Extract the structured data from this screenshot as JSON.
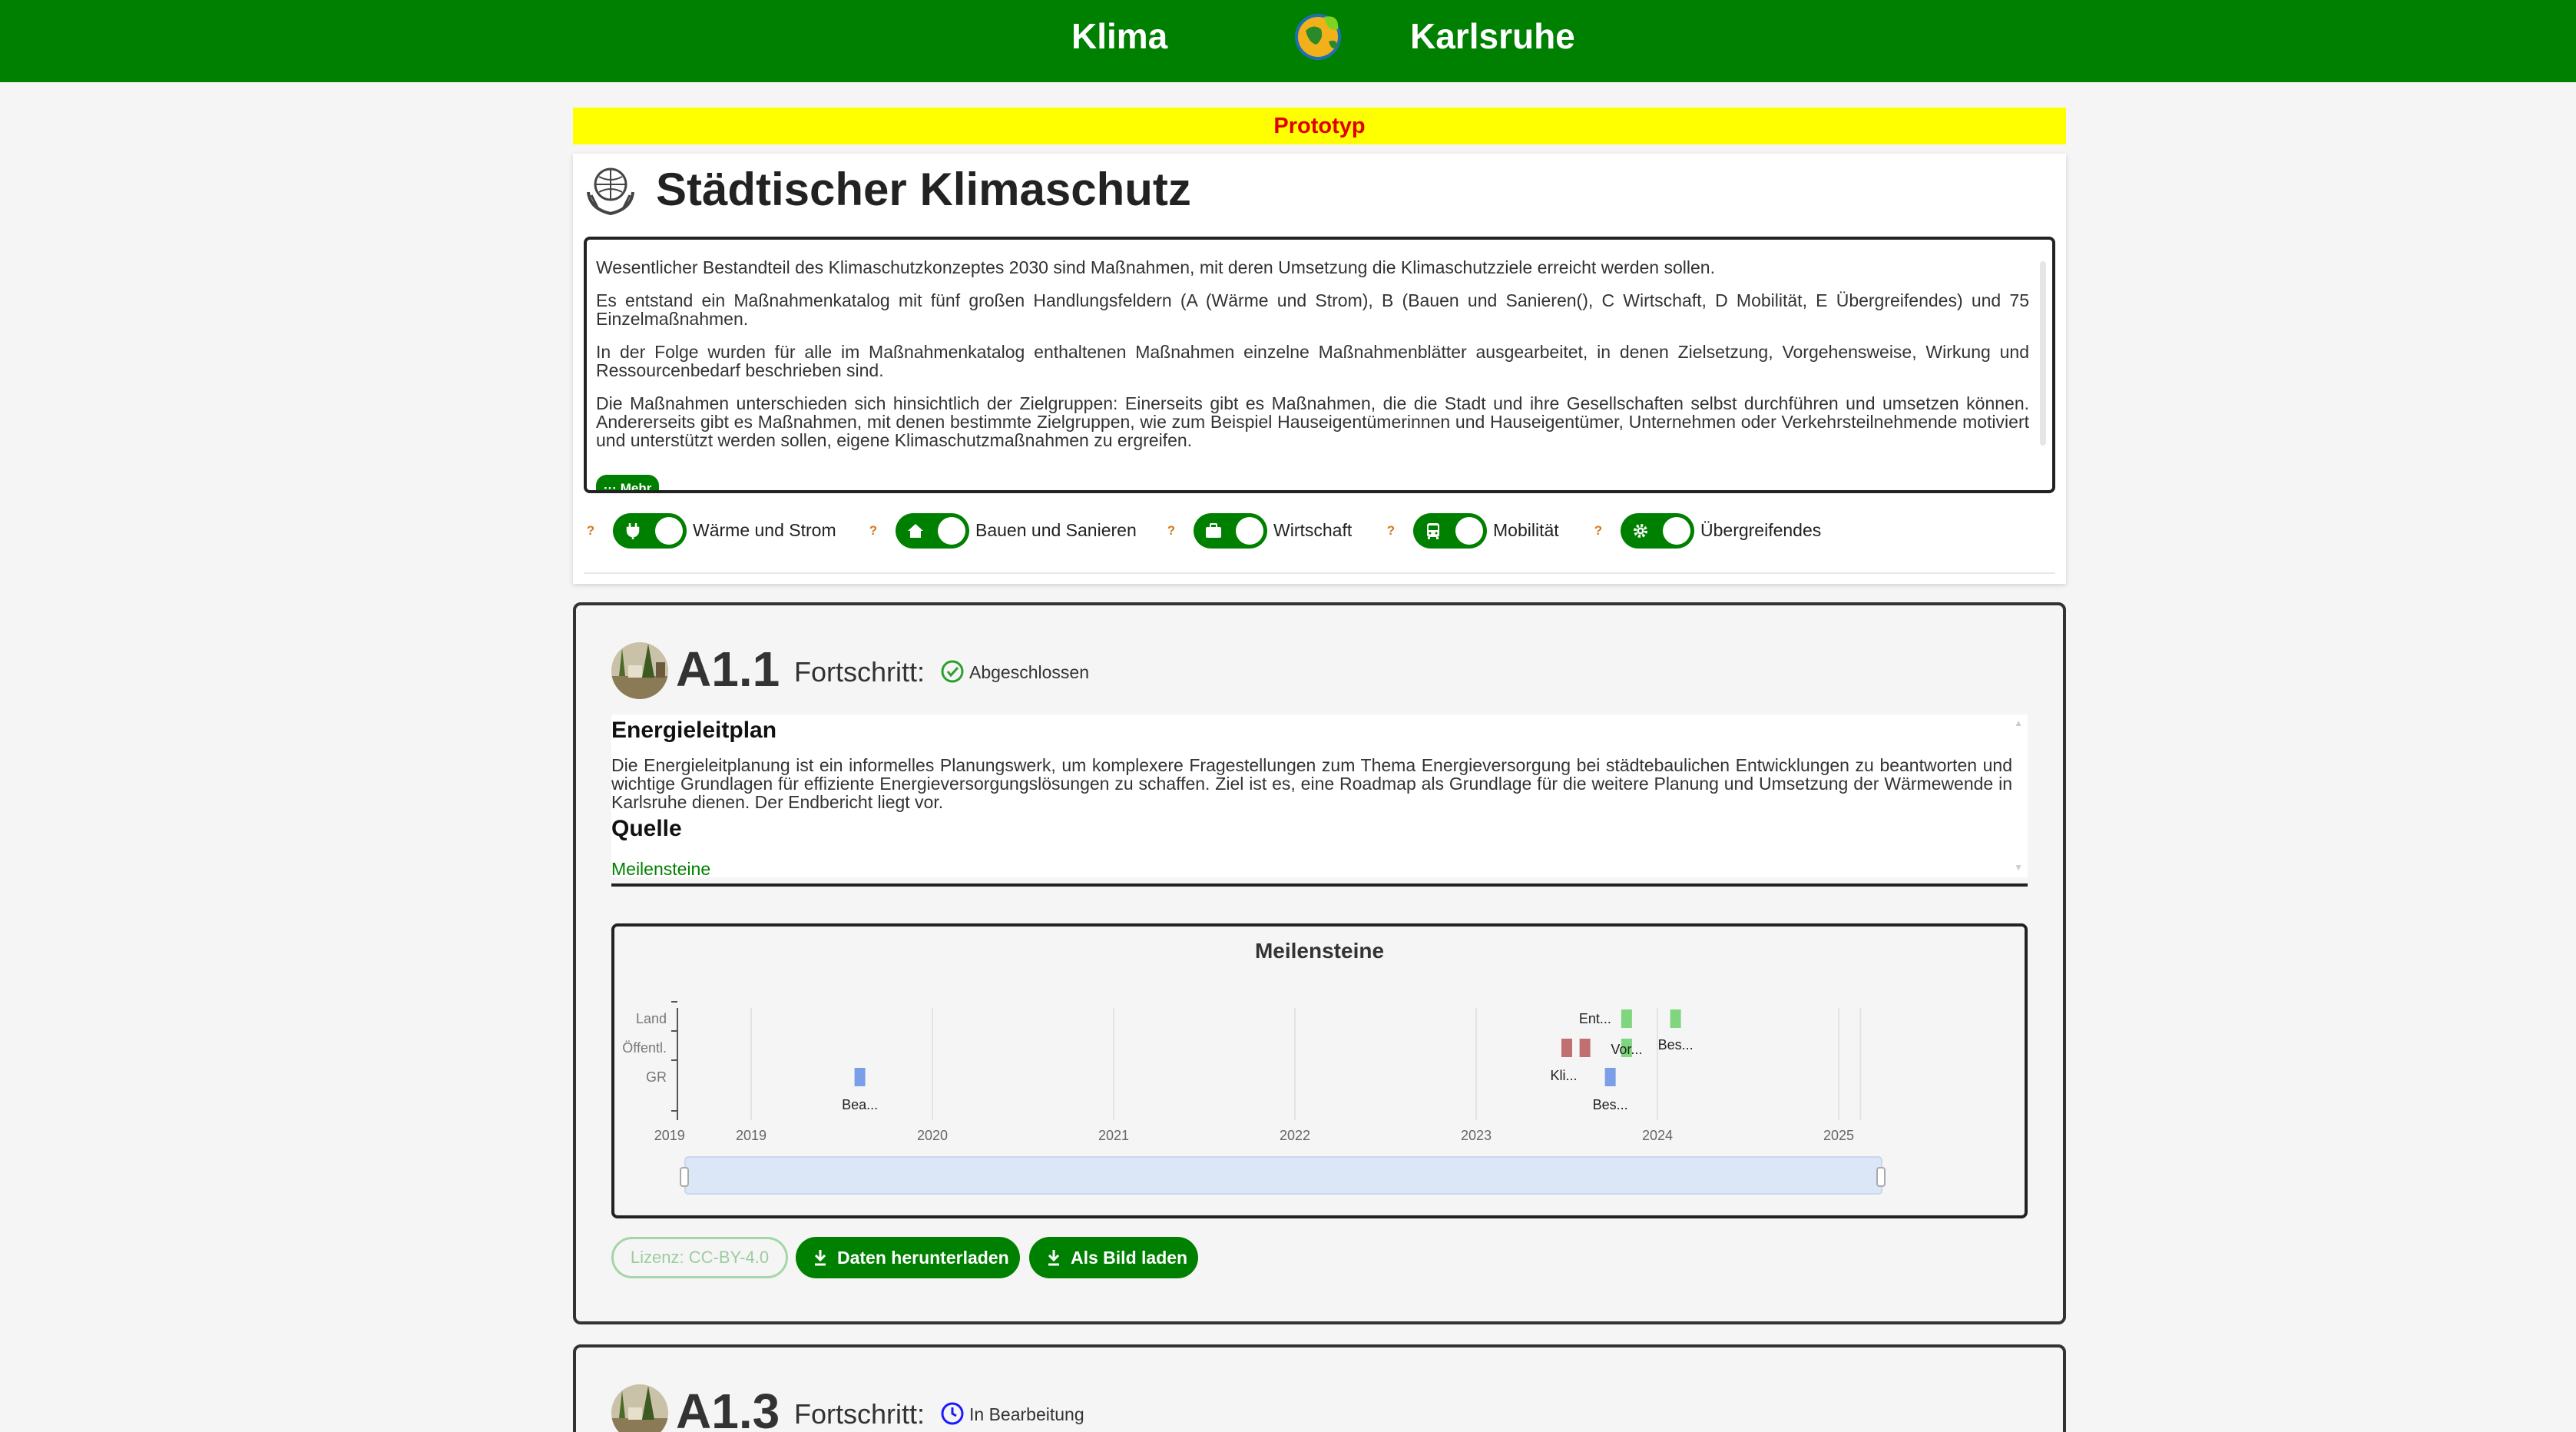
{
  "header": {
    "left": "Klima",
    "right": "Karlsruhe",
    "logo_icon": "globe-leaf-icon"
  },
  "banner": "Prototyp",
  "intro": {
    "title": "Städtischer Klimaschutz",
    "paragraphs": [
      "Wesentlicher Bestandteil des Klimaschutzkonzeptes 2030 sind Maßnahmen, mit deren Umsetzung die Klimaschutzziele erreicht werden sollen.",
      "Es entstand ein Maßnahmenkatalog mit fünf großen Handlungsfeldern (A (Wärme und Strom), B (Bauen und Sanieren(), C Wirtschaft, D Mobilität, E Übergreifendes) und 75 Einzelmaßnahmen.",
      "In der Folge wurden für alle im Maßnahmenkatalog enthaltenen Maßnahmen einzelne Maßnahmenblätter ausgearbeitet, in denen Zielsetzung, Vorgehensweise, Wirkung und Ressourcenbedarf beschrieben sind.",
      "Die Maßnahmen unterschieden sich hinsichtlich der Zielgruppen: Einerseits gibt es Maßnahmen, die die Stadt und ihre Gesellschaften selbst durchführen und umsetzen können. Andererseits gibt es Maßnahmen, mit denen bestimmte Zielgruppen, wie zum Beispiel Hauseigentümerinnen und Hauseigentümer, Unternehmen oder Verkehrsteilnehmende motiviert und unterstützt werden sollen, eigene Klimaschutzmaßnahmen zu ergreifen."
    ],
    "more_label": "··· Mehr",
    "filters": [
      {
        "label": "Wärme und Strom",
        "icon": "plug-icon",
        "help": "?"
      },
      {
        "label": "Bauen und Sanieren",
        "icon": "house-icon",
        "help": "?"
      },
      {
        "label": "Wirtschaft",
        "icon": "briefcase-icon",
        "help": "?"
      },
      {
        "label": "Mobilität",
        "icon": "bus-icon",
        "help": "?"
      },
      {
        "label": "Übergreifendes",
        "icon": "gear-icon",
        "help": "?"
      }
    ]
  },
  "measures": [
    {
      "code": "A1.1",
      "progress_label": "Fortschritt:",
      "status": "Abgeschlossen",
      "status_color": "#2e9e2e",
      "title": "Energieleitplan",
      "description": "Die Energieleitplanung ist ein informelles Planungswerk, um komplexere Fragestellungen zum Thema Energieversorgung bei städtebaulichen Entwicklungen zu beantworten und wichtige Grundlagen für effiziente Energieversorgungslösungen zu schaffen. Ziel ist es, eine Roadmap als Grundlage für die weitere Planung und Umsetzung der Wärmewende in Karlsruhe dienen. Der Endbericht liegt vor.",
      "source_heading": "Quelle",
      "link": "Meilensteine",
      "license": "Lizenz: CC-BY-4.0",
      "download_label": "Daten herunterladen",
      "image_label": "Als Bild laden"
    },
    {
      "code": "A1.3",
      "progress_label": "Fortschritt:",
      "status": "In Bearbeitung",
      "status_color": "#1a1aff"
    }
  ],
  "chart_data": {
    "type": "timeline",
    "title": "Meilensteine",
    "categories": [
      "Land",
      "Öffentl.",
      "GR"
    ],
    "x_ticks": [
      "2019",
      "2019",
      "2020",
      "2021",
      "2022",
      "2023",
      "2024",
      "2025"
    ],
    "events": [
      {
        "label": "Bea...",
        "category": "GR",
        "date": "2019.6",
        "color": "#7b9ee8"
      },
      {
        "label": "Kli...",
        "category": "Öffentl.",
        "date": "2023.5",
        "color": "#c07070"
      },
      {
        "label": "Kli...",
        "category": "Öffentl.",
        "date": "2023.6",
        "color": "#c07070"
      },
      {
        "label": "Ent...",
        "category": "Land",
        "date": "2023.83",
        "color": "#7fd67f"
      },
      {
        "label": "Bes...",
        "category": "GR",
        "date": "2023.74",
        "color": "#7b9ee8"
      },
      {
        "label": "Vor...",
        "category": "Öffentl.",
        "date": "2023.83",
        "color": "#7fd67f"
      },
      {
        "label": "Bes...",
        "category": "Land",
        "date": "2024.1",
        "color": "#7fd67f"
      }
    ]
  }
}
